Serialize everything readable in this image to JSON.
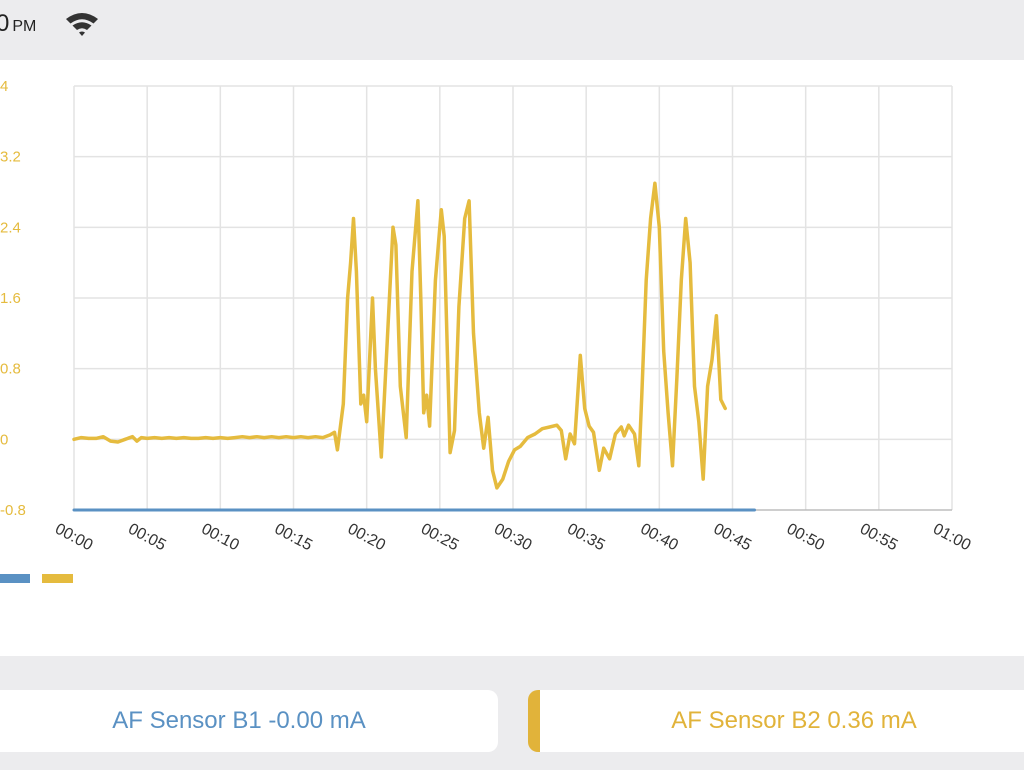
{
  "status_bar": {
    "time": "0",
    "ampm": "PM",
    "wifi_icon": "wifi-icon"
  },
  "chart_data": {
    "type": "line",
    "ylim": [
      -0.8,
      4
    ],
    "y_ticks": [
      "4",
      "3.2",
      "2.4",
      "1.6",
      "0.8",
      "0",
      "-0.8"
    ],
    "x_ticks": [
      "00:00",
      "00:05",
      "00:10",
      "00:15",
      "00:20",
      "00:25",
      "00:30",
      "00:35",
      "00:40",
      "00:45",
      "00:50",
      "00:55",
      "01:00"
    ],
    "xlim_seconds": [
      0,
      60
    ],
    "grid": true,
    "legend": "bottom-left",
    "series": [
      {
        "color": "#5a91c3",
        "points": [
          [
            0,
            -0.8
          ],
          [
            46.5,
            -0.8
          ]
        ]
      },
      {
        "color": "#e5bb3e",
        "points": [
          [
            0,
            0
          ],
          [
            0.5,
            0.02
          ],
          [
            1,
            0.01
          ],
          [
            1.5,
            0.01
          ],
          [
            2,
            0.03
          ],
          [
            2.5,
            -0.02
          ],
          [
            3,
            -0.03
          ],
          [
            3.5,
            0
          ],
          [
            4,
            0.03
          ],
          [
            4.3,
            -0.02
          ],
          [
            4.6,
            0.02
          ],
          [
            5,
            0.01
          ],
          [
            5.5,
            0.02
          ],
          [
            6,
            0.01
          ],
          [
            6.5,
            0.02
          ],
          [
            7,
            0.01
          ],
          [
            7.5,
            0.02
          ],
          [
            8,
            0.01
          ],
          [
            8.5,
            0.01
          ],
          [
            9,
            0.02
          ],
          [
            9.5,
            0.01
          ],
          [
            10,
            0.02
          ],
          [
            10.5,
            0.01
          ],
          [
            11,
            0.02
          ],
          [
            11.5,
            0.03
          ],
          [
            12,
            0.02
          ],
          [
            12.5,
            0.03
          ],
          [
            13,
            0.02
          ],
          [
            13.5,
            0.03
          ],
          [
            14,
            0.02
          ],
          [
            14.5,
            0.03
          ],
          [
            15,
            0.02
          ],
          [
            15.5,
            0.03
          ],
          [
            16,
            0.02
          ],
          [
            16.5,
            0.03
          ],
          [
            17,
            0.02
          ],
          [
            17.5,
            0.05
          ],
          [
            17.8,
            0.08
          ],
          [
            18,
            -0.12
          ],
          [
            18.4,
            0.4
          ],
          [
            18.7,
            1.6
          ],
          [
            18.9,
            2.0
          ],
          [
            19.1,
            2.5
          ],
          [
            19.3,
            1.9
          ],
          [
            19.6,
            0.4
          ],
          [
            19.8,
            0.5
          ],
          [
            20,
            0.2
          ],
          [
            20.4,
            1.6
          ],
          [
            20.6,
            0.8
          ],
          [
            21,
            -0.2
          ],
          [
            21.4,
            1.1
          ],
          [
            21.8,
            2.4
          ],
          [
            22,
            2.2
          ],
          [
            22.3,
            0.6
          ],
          [
            22.7,
            0.02
          ],
          [
            23.1,
            1.9
          ],
          [
            23.5,
            2.7
          ],
          [
            23.7,
            1.6
          ],
          [
            23.9,
            0.3
          ],
          [
            24.1,
            0.5
          ],
          [
            24.3,
            0.15
          ],
          [
            24.7,
            1.8
          ],
          [
            25.1,
            2.6
          ],
          [
            25.3,
            2.3
          ],
          [
            25.7,
            -0.15
          ],
          [
            26,
            0.1
          ],
          [
            26.3,
            1.5
          ],
          [
            26.7,
            2.5
          ],
          [
            27,
            2.7
          ],
          [
            27.3,
            1.2
          ],
          [
            27.7,
            0.3
          ],
          [
            28,
            -0.1
          ],
          [
            28.3,
            0.25
          ],
          [
            28.6,
            -0.35
          ],
          [
            28.9,
            -0.55
          ],
          [
            29.3,
            -0.45
          ],
          [
            29.7,
            -0.25
          ],
          [
            30.1,
            -0.12
          ],
          [
            30.5,
            -0.08
          ],
          [
            31,
            0.02
          ],
          [
            31.5,
            0.06
          ],
          [
            32,
            0.12
          ],
          [
            32.5,
            0.14
          ],
          [
            33,
            0.16
          ],
          [
            33.3,
            0.1
          ],
          [
            33.6,
            -0.22
          ],
          [
            33.9,
            0.06
          ],
          [
            34.2,
            -0.05
          ],
          [
            34.6,
            0.95
          ],
          [
            34.9,
            0.35
          ],
          [
            35.2,
            0.15
          ],
          [
            35.5,
            0.08
          ],
          [
            35.9,
            -0.35
          ],
          [
            36.2,
            -0.1
          ],
          [
            36.6,
            -0.22
          ],
          [
            37,
            0.06
          ],
          [
            37.4,
            0.14
          ],
          [
            37.6,
            0.04
          ],
          [
            37.9,
            0.16
          ],
          [
            38.3,
            0.06
          ],
          [
            38.6,
            -0.3
          ],
          [
            38.8,
            0.5
          ],
          [
            39.1,
            1.8
          ],
          [
            39.4,
            2.5
          ],
          [
            39.7,
            2.9
          ],
          [
            40,
            2.4
          ],
          [
            40.3,
            1.0
          ],
          [
            40.6,
            0.3
          ],
          [
            40.9,
            -0.3
          ],
          [
            41.2,
            0.7
          ],
          [
            41.5,
            1.8
          ],
          [
            41.8,
            2.5
          ],
          [
            42.1,
            2.0
          ],
          [
            42.4,
            0.6
          ],
          [
            42.7,
            0.2
          ],
          [
            43,
            -0.45
          ],
          [
            43.3,
            0.6
          ],
          [
            43.6,
            0.9
          ],
          [
            43.9,
            1.4
          ],
          [
            44.2,
            0.45
          ],
          [
            44.5,
            0.35
          ]
        ]
      }
    ]
  },
  "legend": {
    "series1_color": "#5a91c3",
    "series2_color": "#e5bb3e"
  },
  "sensors": {
    "b1_label": "AF Sensor B1 -0.00 mA",
    "b2_label": "AF Sensor B2 0.36 mA"
  }
}
